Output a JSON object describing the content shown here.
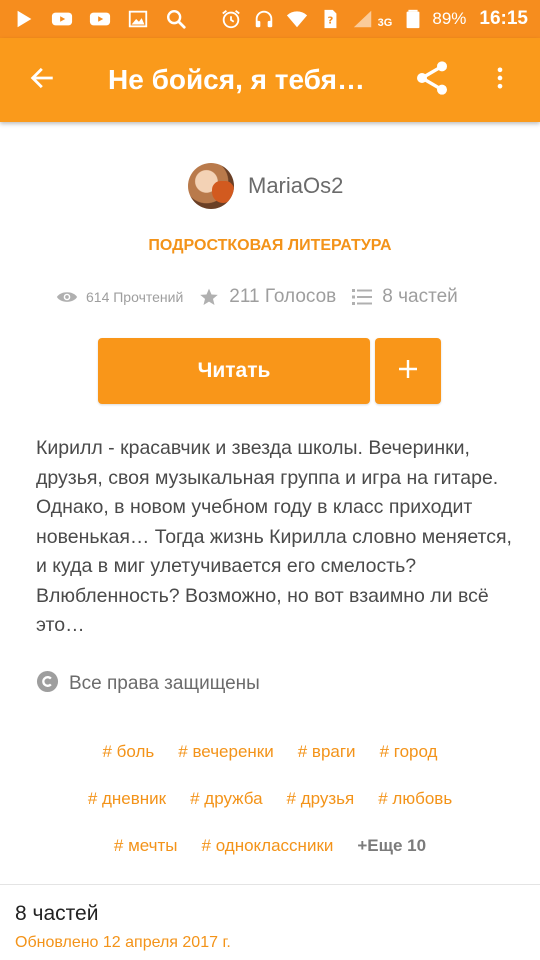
{
  "status_bar": {
    "network": "3G",
    "battery": "89%",
    "time": "16:15"
  },
  "app_bar": {
    "title": "Не бойся, я тебя…",
    "icons": {
      "back": "arrow-left",
      "share": "share",
      "more": "more-vertical"
    }
  },
  "story": {
    "author": "MariaOs2",
    "category": "ПОДРОСТКОВАЯ ЛИТЕРАТУРА",
    "stats": {
      "reads": "614 Прочтений",
      "votes": "211 Голосов",
      "parts": "8 частей"
    },
    "read_button": "Читать",
    "add_button": "+",
    "description": "Кирилл - красавчик и звезда школы. Вечеринки, друзья, своя музыкальная группа и игра на гитаре. Однако, в новом учебном году в класс приходит новенькая… Тогда жизнь Кирилла словно меняется, и куда в миг улетучивается его смелость? Влюбленность? Возможно, но вот взаимно ли всё это…",
    "copyright": "Все права защищены"
  },
  "tags": [
    [
      "# боль",
      "# вечеренки",
      "# враги",
      "# город"
    ],
    [
      "# дневник",
      "# дружба",
      "# друзья",
      "# любовь"
    ],
    [
      "# мечты",
      "# одноклассники"
    ]
  ],
  "tags_more": "+Еще 10",
  "parts_section": {
    "title": "8 частей",
    "updated": "Обновлено 12 апреля 2017 г."
  },
  "colors": {
    "accent": "#f99619",
    "app_bar": "#fa9a1b",
    "status_bar": "#f68d1e",
    "tag": "#f39319"
  }
}
